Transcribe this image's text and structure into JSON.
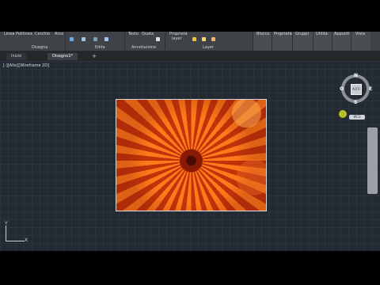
{
  "ribbon": {
    "top_labels": [
      "Linea",
      "Polilinea",
      "Cerchio",
      "Arco",
      "Testo",
      "Quota",
      "Proprietà",
      "layer"
    ],
    "right_buttons": [
      "Blocco",
      "Proprietà",
      "Gruppi",
      "Utilità",
      "Appunti",
      "Vista"
    ],
    "sections": [
      "Disegna",
      "Edita",
      "Annotazione",
      "Layer"
    ]
  },
  "tabs": {
    "items": [
      "Inizio",
      "Disegno1*"
    ],
    "add_symbol": "+"
  },
  "viewport": {
    "label": "[-][Alto][Wireframe 2D]"
  },
  "viewcube": {
    "cube_label": "ALTO",
    "north": "N",
    "south": "S",
    "east": "E",
    "west": "O",
    "wcs": "WCS"
  },
  "ucs": {
    "x": "X",
    "y": "Y"
  },
  "image": {
    "subject": "orange-chrysanthemum-photo"
  }
}
